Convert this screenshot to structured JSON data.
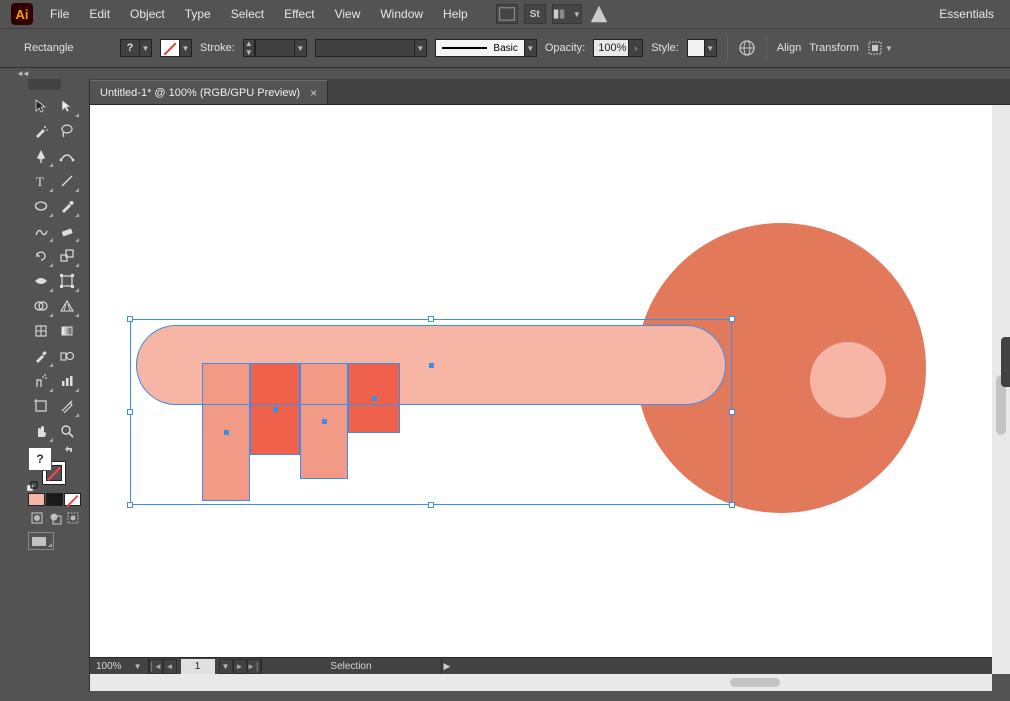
{
  "app": {
    "logo_text": "Ai"
  },
  "menu": {
    "items": [
      "File",
      "Edit",
      "Object",
      "Type",
      "Select",
      "Effect",
      "View",
      "Window",
      "Help"
    ]
  },
  "workspace": {
    "label": "Essentials"
  },
  "controlbar": {
    "tool_name": "Rectangle",
    "fill_label": "?",
    "stroke_label": "Stroke:",
    "brush_style_label": "Basic",
    "opacity_label": "Opacity:",
    "opacity_value": "100%",
    "style_label": "Style:",
    "align_label": "Align",
    "transform_label": "Transform"
  },
  "document": {
    "tab_title": "Untitled-1* @ 100% (RGB/GPU Preview)"
  },
  "toolbox": {
    "fill_mark": "?"
  },
  "statusbar": {
    "zoom": "100%",
    "page": "1",
    "tool_label": "Selection"
  },
  "colors": {
    "key_head": "#e2795b",
    "key_light": "#f6b5a5",
    "tooth_mid": "#f29a86",
    "tooth_dark": "#ef614b",
    "selection": "#3b8eea"
  }
}
